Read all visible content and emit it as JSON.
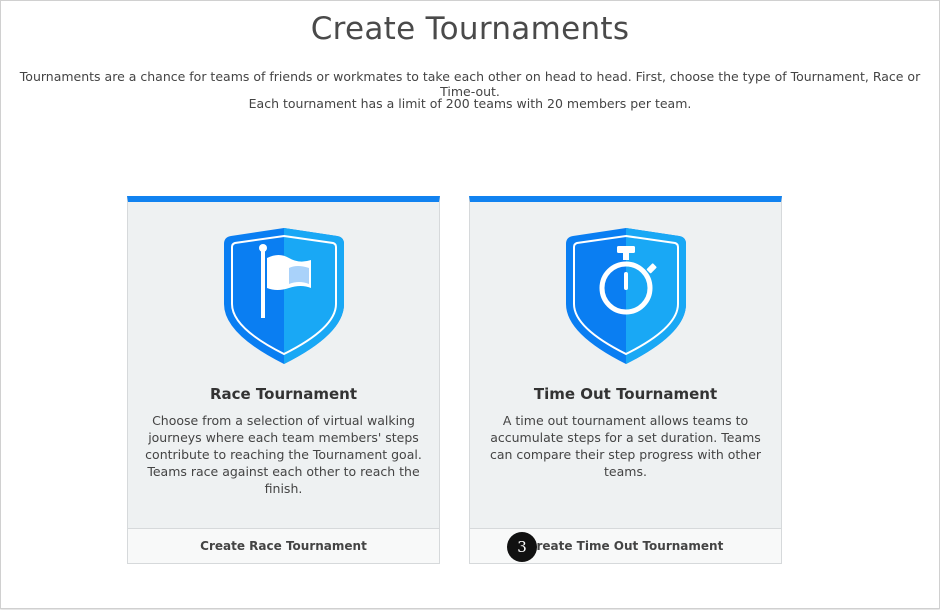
{
  "page": {
    "title": "Create Tournaments",
    "intro_line1": "Tournaments are a chance for teams of friends or workmates to take each other on head to head. First, choose the type of Tournament, Race or Time-out.",
    "intro_line2": "Each tournament has a limit of 200 teams with 20 members per team."
  },
  "cards": {
    "race": {
      "icon": "flag-shield-icon",
      "title": "Race Tournament",
      "description": "Choose from a selection of virtual walking journeys where each team members' steps contribute to reaching the Tournament goal. Teams race against each other to reach the finish.",
      "button_label": "Create Race Tournament"
    },
    "timeout": {
      "icon": "stopwatch-shield-icon",
      "title": "Time Out Tournament",
      "description": "A time out tournament allows teams to accumulate steps for a set duration. Teams can compare their step progress with other teams.",
      "button_label": "Create Time Out Tournament"
    }
  },
  "annotation": {
    "step_number": "3"
  },
  "colors": {
    "accent": "#1182f0",
    "shield_dark": "#0a7ef2",
    "shield_light": "#19a8f5",
    "card_bg": "#eef1f2"
  }
}
